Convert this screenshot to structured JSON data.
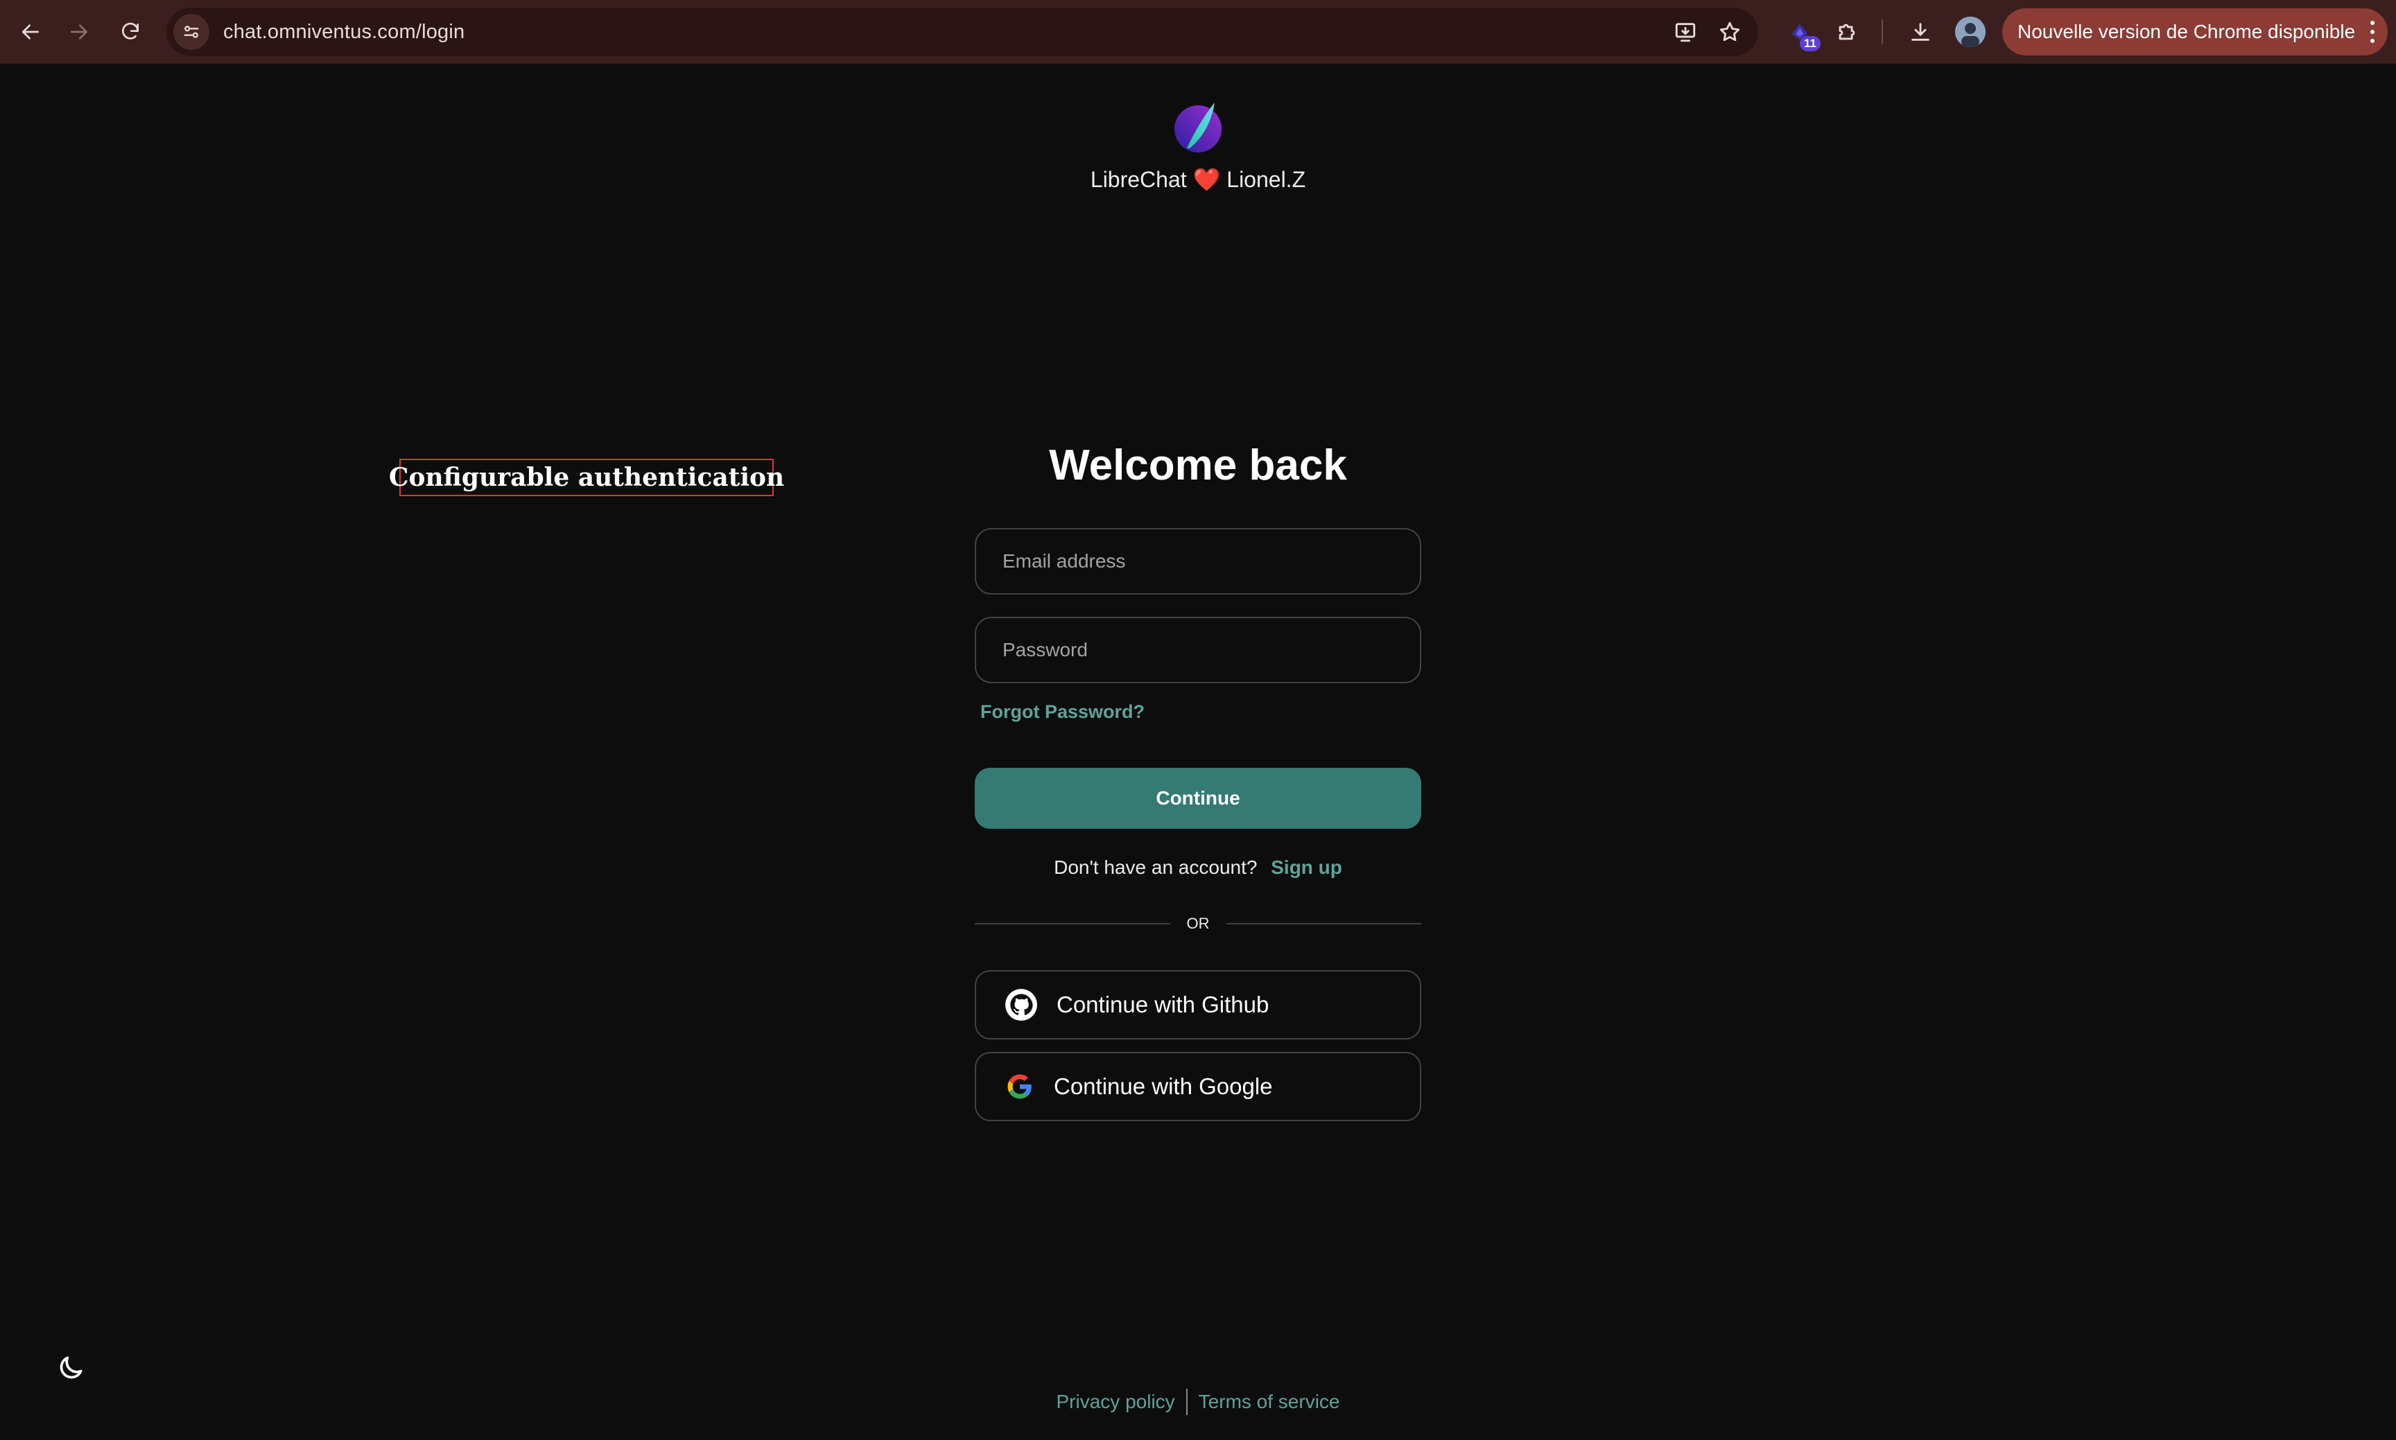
{
  "browser": {
    "url": "chat.omniventus.com/login",
    "extension_badge": "11",
    "update_label": "Nouvelle version de Chrome disponible"
  },
  "brand": {
    "name_left": "LibreChat",
    "heart": "❤️",
    "name_right": "Lionel.Z"
  },
  "annotation": {
    "label": "Configurable authentication"
  },
  "login": {
    "title": "Welcome back",
    "email_placeholder": "Email address",
    "password_placeholder": "Password",
    "forgot_password": "Forgot Password?",
    "continue_label": "Continue",
    "no_account_text": "Don't have an account?",
    "signup_link": "Sign up",
    "divider_text": "OR",
    "github_label": "Continue with Github",
    "google_label": "Continue with Google"
  },
  "footer": {
    "privacy": "Privacy policy",
    "terms": "Terms of service"
  },
  "colors": {
    "background": "#0d0d0d",
    "accent": "#357b73",
    "link": "#5fa39a",
    "chrome_bar": "#3b1f1e",
    "update_pill": "#8c3b35"
  },
  "icons": [
    "back-arrow-icon",
    "forward-arrow-icon",
    "reload-icon",
    "site-settings-icon",
    "install-app-icon",
    "bookmark-star-icon",
    "extension-icon",
    "puzzle-icon",
    "download-icon",
    "github-icon",
    "google-icon",
    "moon-icon"
  ]
}
